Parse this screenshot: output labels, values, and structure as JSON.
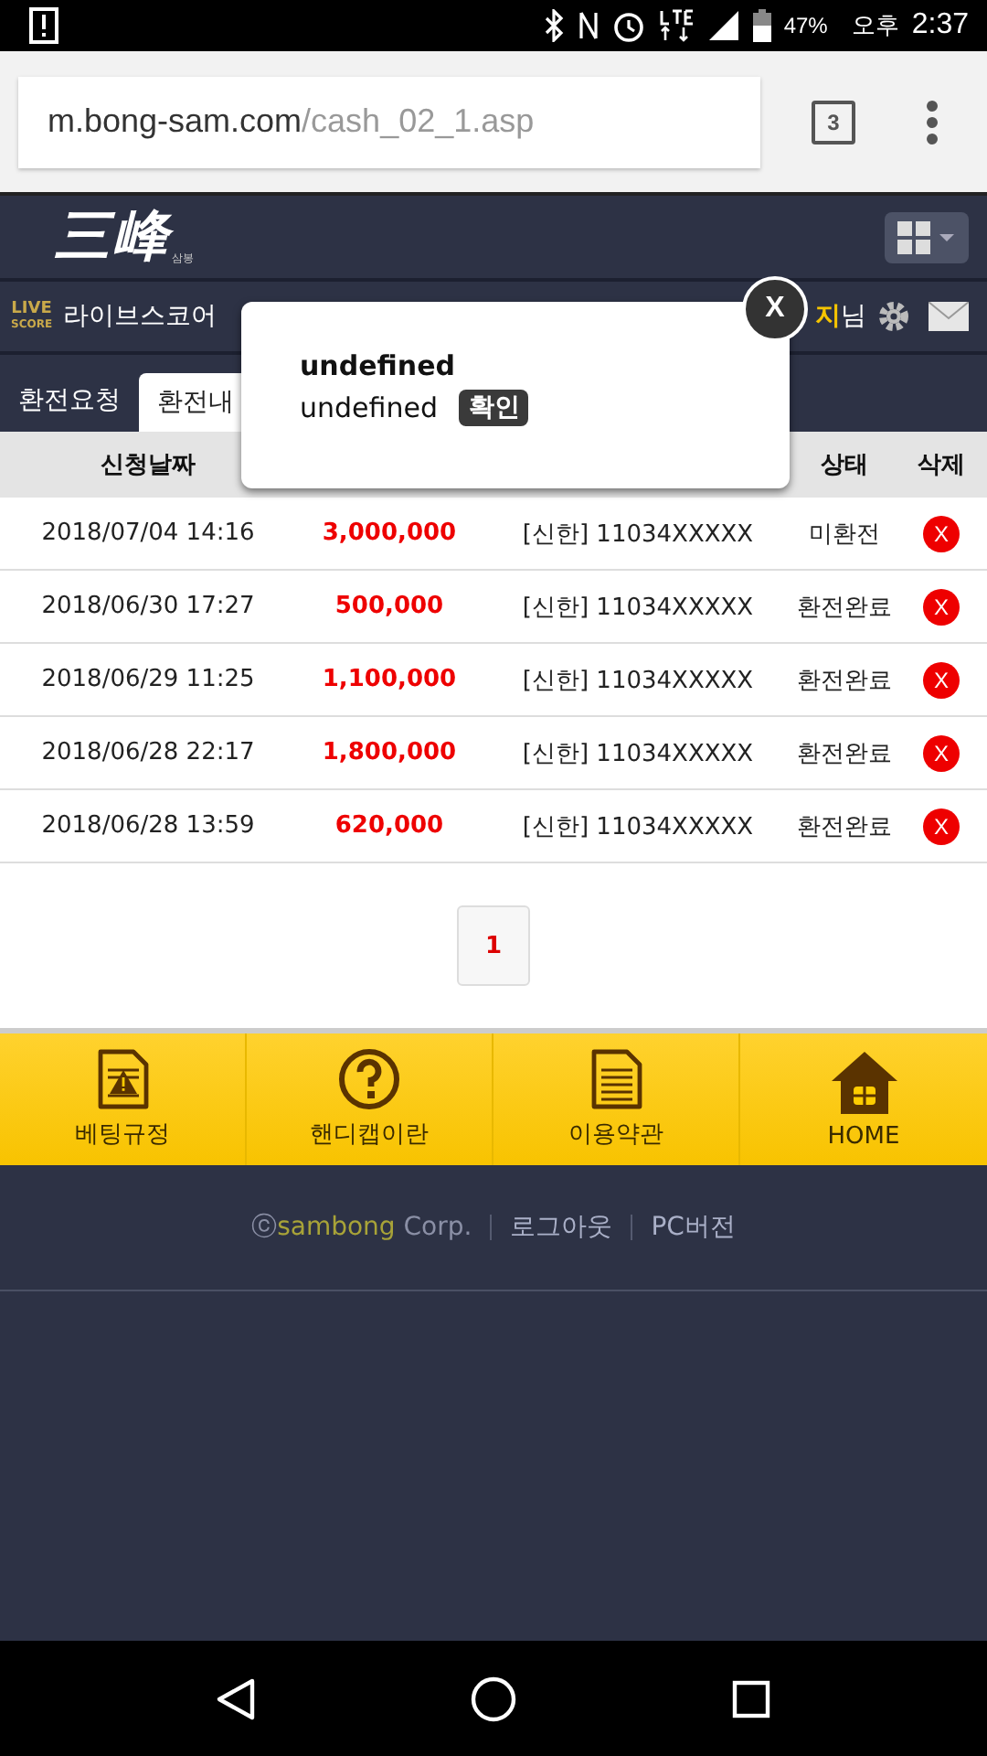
{
  "status_bar": {
    "battery": "47%",
    "period": "오후",
    "time": "2:37"
  },
  "browser": {
    "url_host": "m.bong-sam.com",
    "url_path": "/cash_02_1.asp",
    "tab_count": "3"
  },
  "header": {
    "logo": "三峰",
    "logo_sub": "삼봉"
  },
  "sub_bar": {
    "live_top": "LIVE",
    "live_bottom": "SCORE",
    "live_label": "라이브스코어",
    "user_name": "지",
    "user_suffix": "님"
  },
  "tabs": [
    {
      "label": "환전요청",
      "selected": false
    },
    {
      "label": "환전내",
      "selected": true
    }
  ],
  "table": {
    "columns": [
      "신청날짜",
      "상태",
      "삭제"
    ],
    "rows": [
      {
        "date": "2018/07/04 14:16",
        "amount": "3,000,000",
        "account": "[신한] 11034XXXXX",
        "status": "미환전",
        "delete": "X"
      },
      {
        "date": "2018/06/30 17:27",
        "amount": "500,000",
        "account": "[신한] 11034XXXXX",
        "status": "환전완료",
        "delete": "X"
      },
      {
        "date": "2018/06/29 11:25",
        "amount": "1,100,000",
        "account": "[신한] 11034XXXXX",
        "status": "환전완료",
        "delete": "X"
      },
      {
        "date": "2018/06/28 22:17",
        "amount": "1,800,000",
        "account": "[신한] 11034XXXXX",
        "status": "환전완료",
        "delete": "X"
      },
      {
        "date": "2018/06/28 13:59",
        "amount": "620,000",
        "account": "[신한] 11034XXXXX",
        "status": "환전완료",
        "delete": "X"
      }
    ]
  },
  "pagination": [
    {
      "label": "1",
      "selected": true
    }
  ],
  "footer_menu": [
    {
      "kind": "rules",
      "label": "베팅규정"
    },
    {
      "kind": "help",
      "label": "핸디캡이란"
    },
    {
      "kind": "terms",
      "label": "이용약관"
    },
    {
      "kind": "home",
      "label": "HOME"
    }
  ],
  "footer": {
    "copyright_mark": "ⓒ",
    "brand": "sambong",
    "corp": "Corp.",
    "links": [
      "로그아웃",
      "PC버전"
    ]
  },
  "dialog": {
    "title": "undefined",
    "message": "undefined",
    "confirm": "확인",
    "close": "X"
  }
}
